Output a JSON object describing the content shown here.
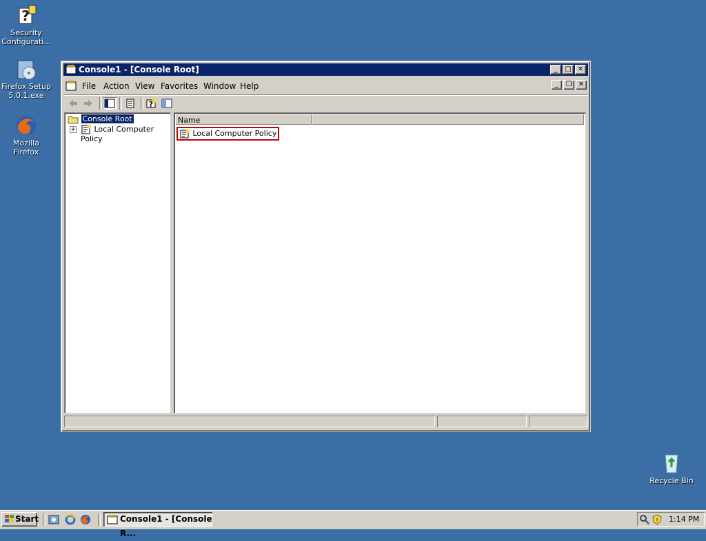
{
  "desktop": {
    "icons": [
      {
        "label": "Security\nConfigurati...",
        "icon": "security-config-icon"
      },
      {
        "label": "Firefox Setup\n5.0.1.exe",
        "icon": "installer-icon"
      },
      {
        "label": "Mozilla Firefox",
        "icon": "firefox-icon"
      },
      {
        "label": "Recycle Bin",
        "icon": "recycle-bin-icon"
      }
    ]
  },
  "window": {
    "title": "Console1 - [Console Root]",
    "title_color": "#0a246a",
    "caption_buttons": {
      "minimize": "_",
      "maximize": "□",
      "close": "✕"
    },
    "menu": [
      "File",
      "Action",
      "View",
      "Favorites",
      "Window",
      "Help"
    ],
    "mdi_buttons": {
      "minimize": "_",
      "restore": "❐",
      "close": "✕"
    },
    "tree": {
      "root": "Console Root",
      "children": [
        "Local Computer Policy"
      ],
      "expander": "+"
    },
    "list": {
      "column_header": "Name",
      "items": [
        "Local Computer Policy"
      ],
      "highlight_color": "#cc0000"
    }
  },
  "taskbar": {
    "start_label": "Start",
    "task_label": "Console1 - [Console R...",
    "clock": "1:14 PM"
  }
}
